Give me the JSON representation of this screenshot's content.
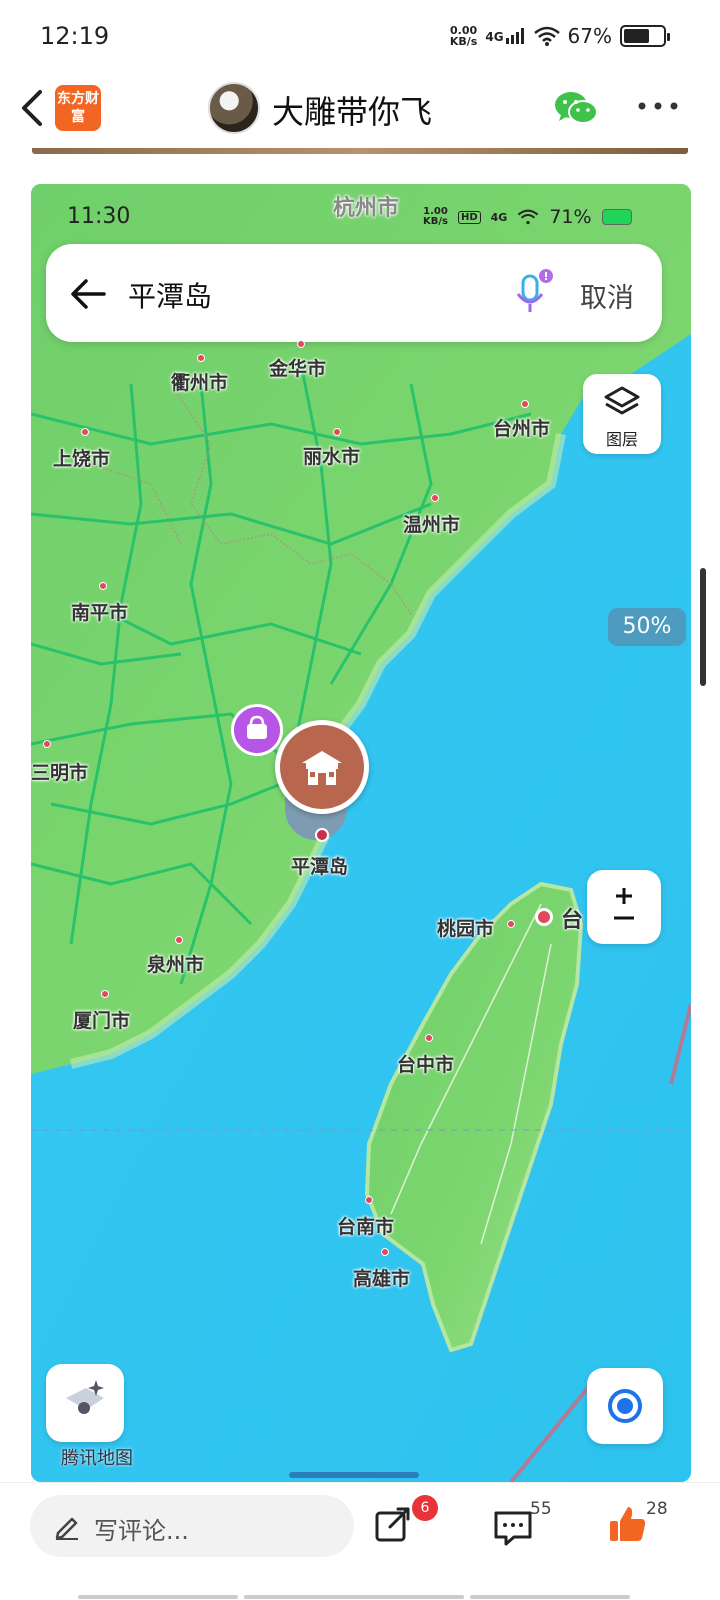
{
  "status_bar": {
    "time": "12:19",
    "speed_value": "0.00",
    "speed_unit": "KB/s",
    "network": "4G",
    "battery": "67%",
    "battery_level": 0.67
  },
  "header": {
    "app_logo_text": "东方财富",
    "user_name": "大雕带你飞",
    "icons": [
      "back-icon",
      "wechat-icon",
      "more-icon"
    ]
  },
  "map_screenshot": {
    "status": {
      "time": "11:30",
      "speed_value": "1.00",
      "speed_unit": "KB/s",
      "hd": "HD",
      "network": "4G",
      "battery": "71%"
    },
    "search": {
      "query": "平潭岛",
      "cancel_label": "取消"
    },
    "layers_label": "图层",
    "zoom_label": "±",
    "brand": "腾讯地图",
    "labels": {
      "hangzhou": "杭州市",
      "quzhou": "衢州市",
      "jinhua": "金华市",
      "taizhou": "台州市",
      "shangrao": "上饶市",
      "lishui": "丽水市",
      "wenzhou": "温州市",
      "nanping": "南平市",
      "sanming": "三明市",
      "pingtan": "平潭岛",
      "taoyuan": "桃园市",
      "taipei": "台",
      "quanzhou": "泉州市",
      "xiamen": "厦门市",
      "taichung": "台中市",
      "tainan": "台南市",
      "kaohsiung": "高雄市"
    }
  },
  "scroll_indicator": "50%",
  "bottom_bar": {
    "comment_placeholder": "写评论...",
    "share_badge": "6",
    "comment_count": "55",
    "like_count": "28"
  }
}
